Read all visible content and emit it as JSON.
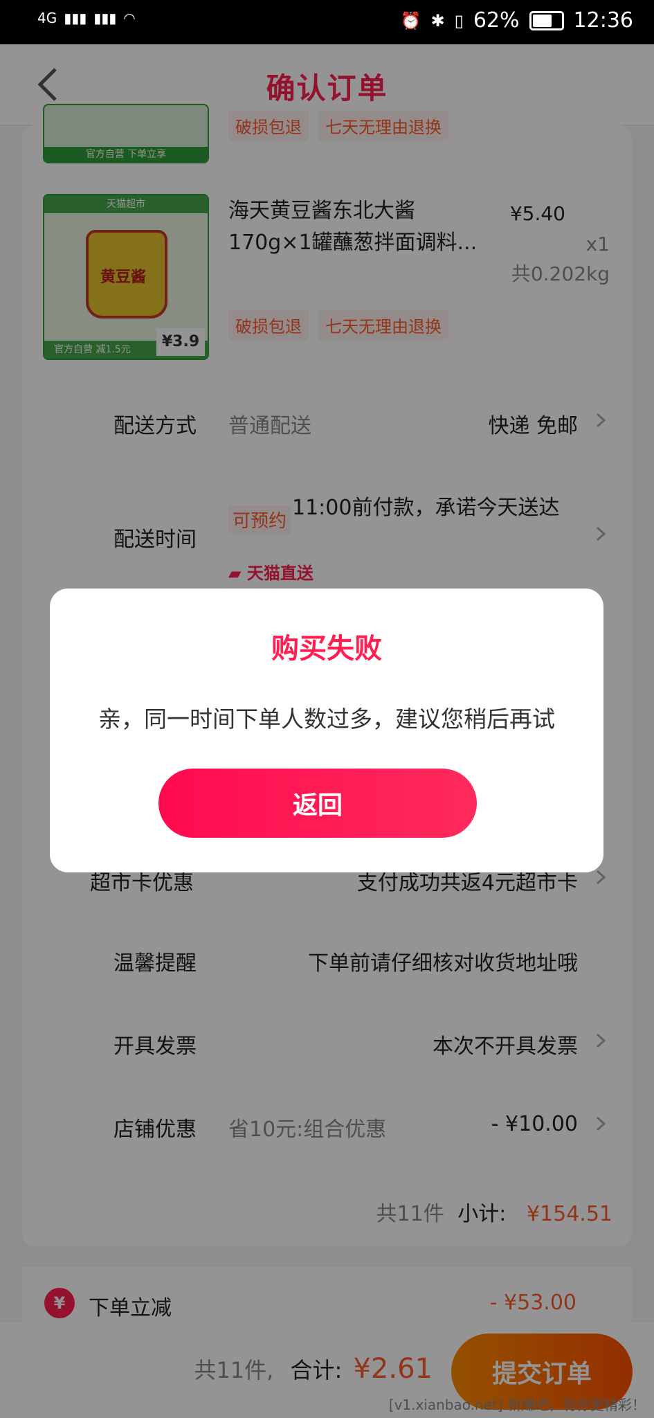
{
  "status_bar": {
    "network": "4G",
    "battery": "62%",
    "time": "12:36"
  },
  "header": {
    "title": "确认订单"
  },
  "products": [
    {
      "thumb_band": "官方自营 下单立享",
      "tags": [
        "破损包退",
        "七天无理由退换"
      ]
    },
    {
      "thumb_top_band": "天猫超市",
      "thumb_jar_label": "黄豆酱",
      "thumb_bottom_band": "官方自营 减1.5元",
      "thumb_price": "¥3.9",
      "name": "海天黄豆酱东北大酱170g×1罐蘸葱拌面调料...",
      "price": "¥5.40",
      "qty": "x1",
      "weight": "共0.202kg",
      "tags": [
        "破损包退",
        "七天无理由退换"
      ]
    }
  ],
  "rows": {
    "delivery_method": {
      "label": "配送方式",
      "sub": "普通配送",
      "value": "快递 免邮"
    },
    "delivery_time": {
      "label": "配送时间",
      "badge": "可预约",
      "value": "11:00前付款，承诺今天送达",
      "extra": "天猫直送"
    },
    "supermarket_card": {
      "label": "超市卡优惠",
      "value": "支付成功共返4元超市卡"
    },
    "reminder": {
      "label": "温馨提醒",
      "value": "下单前请仔细核对收货地址哦"
    },
    "invoice": {
      "label": "开具发票",
      "value": "本次不开具发票"
    },
    "shop_discount": {
      "label": "店铺优惠",
      "sub": "省10元:组合优惠",
      "value": "- ¥10.00"
    }
  },
  "subtotal": {
    "count": "共11件",
    "label": "小计:",
    "amount": "¥154.51"
  },
  "discount": {
    "icon": "¥",
    "label": "下单立减",
    "value": "- ¥53.00"
  },
  "bottom": {
    "count": "共11件,",
    "total_label": "合计:",
    "total": "¥2.61",
    "submit": "提交订单"
  },
  "dialog": {
    "title": "购买失败",
    "message": "亲，同一时间下单人数过多，建议您稍后再试",
    "button": "返回"
  },
  "watermark": "[v1.xianbao.net] 新赚吧，有你更精彩！",
  "colors": {
    "accent": "#ff1f50",
    "orange": "#ff5a2e",
    "submit": "#ff6a00"
  }
}
